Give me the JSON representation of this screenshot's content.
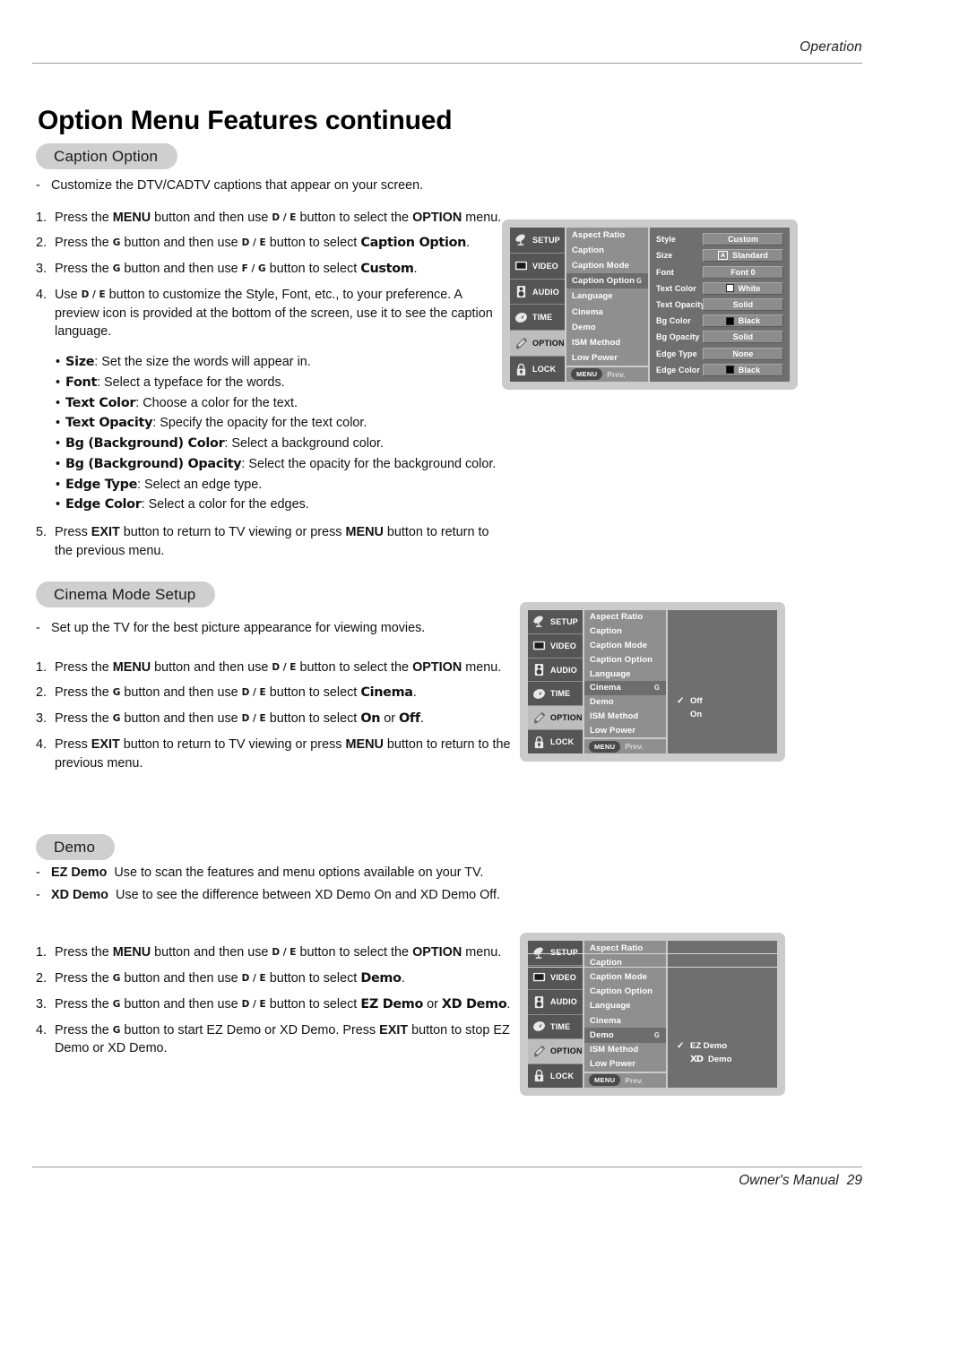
{
  "header": {
    "running_head": "Operation"
  },
  "title": "Option Menu Features continued",
  "footer": {
    "text": "Owner's Manual",
    "page": "29"
  },
  "sections": [
    {
      "pill": "Caption Option",
      "intro": "Customize the DTV/CADTV captions that appear on your screen.",
      "steps": [
        "1.|Press the |MENU| button and then use |D / E| button to select the |OPTION| menu.",
        "2.|Press the |G| button and then use |D / E| button to select |Caption Option|.",
        "3.|Press the |G| button and then use |F / G| button to select |Custom|.",
        "4.|Use |D / E| button to customize the Style, Font, etc., to your preference. A preview icon is provided at the bottom of the screen, use it to see the caption language."
      ],
      "bullets": [
        {
          "term": "Size",
          "desc": ": Set the size the words will appear in."
        },
        {
          "term": "Font",
          "desc": ": Select a typeface for the words."
        },
        {
          "term": "Text Color",
          "desc": ": Choose a color for the text."
        },
        {
          "term": "Text Opacity",
          "desc": ": Specify the opacity for the text color."
        },
        {
          "term": "Bg (Background) Color",
          "desc": ": Select a background color."
        },
        {
          "term": "Bg (Background) Opacity",
          "desc": ": Select the opacity for the background color."
        },
        {
          "term": "Edge Type",
          "desc": ": Select an edge type."
        },
        {
          "term": "Edge Color",
          "desc": ": Select a color for the edges."
        }
      ],
      "last_step": "5."
    },
    {
      "pill": "Cinema Mode Setup",
      "intro": "Set up the TV for the best picture appearance for viewing movies."
    },
    {
      "pill": "Demo",
      "dash1_term": "EZ Demo",
      "dash1_desc": "Use to scan the features and menu options available on your TV.",
      "dash2_term": "XD Demo",
      "dash2_desc": "Use to see the difference between XD Demo On and XD Demo Off."
    }
  ],
  "text": {
    "press_the": "Press the",
    "button_and_then_use": "button and then use",
    "button_to_select_the": "button to select the",
    "button_to_select": "button to select",
    "menu_word": "menu",
    "menu_period": "menu.",
    "or_word": "or",
    "use_word": "Use",
    "btn_menu": "MENU",
    "btn_option": "OPTION",
    "btn_exit": "EXIT",
    "btn_custom": "Custom",
    "btn_caption_option": "Caption Option",
    "btn_cinema": "Cinema",
    "btn_demo": "Demo",
    "btn_on": "On",
    "btn_off": "Off",
    "btn_ez_demo": "EZ Demo",
    "btn_xd_demo": "XD Demo",
    "key_de": "D / E",
    "key_fg": "F / G",
    "key_g": "G",
    "s1_step4_rest": "button to customize the Style, Font, etc., to your preference. A preview icon is provided at the bottom of the screen, use it to see the caption language.",
    "s1_step5": "Press EXIT button to return to TV viewing or press MENU button to return to the previous menu.",
    "s2_step4": "Press EXIT button to return to TV viewing or press MENU button to return to the previous menu.",
    "s3_step4_a": "button to start EZ Demo or XD Demo. Press",
    "s3_step4_b": "button to stop EZ Demo or XD Demo."
  },
  "osd": {
    "sidebar": [
      {
        "label": "SETUP",
        "icon": "satellite-dish-icon"
      },
      {
        "label": "VIDEO",
        "icon": "tv-screen-icon"
      },
      {
        "label": "AUDIO",
        "icon": "speaker-icon"
      },
      {
        "label": "TIME",
        "icon": "clock-icon"
      },
      {
        "label": "OPTION",
        "icon": "tag-icon"
      },
      {
        "label": "LOCK",
        "icon": "padlock-icon"
      }
    ],
    "menu_items": [
      "Aspect Ratio",
      "Caption",
      "Caption Mode",
      "Caption Option",
      "Language",
      "Cinema",
      "Demo",
      "ISM Method",
      "Low Power"
    ],
    "menu_chip": "MENU",
    "prev_label": "Prev.",
    "arrow_glyph": "G",
    "check_glyph": "✓",
    "diagram1": {
      "selected_item": "Caption Option",
      "rows": [
        {
          "label": "Style",
          "value": "Custom",
          "swatch": null,
          "abox": false
        },
        {
          "label": "Size",
          "value": "Standard",
          "swatch": null,
          "abox": true
        },
        {
          "label": "Font",
          "value": "Font  0",
          "swatch": null,
          "abox": false
        },
        {
          "label": "Text Color",
          "value": "White",
          "swatch": "#ffffff",
          "abox": false
        },
        {
          "label": "Text Opacity",
          "value": "Solid",
          "swatch": null,
          "abox": false
        },
        {
          "label": "Bg Color",
          "value": "Black",
          "swatch": "#000000",
          "abox": false
        },
        {
          "label": "Bg Opacity",
          "value": "Solid",
          "swatch": null,
          "abox": false
        },
        {
          "label": "Edge Type",
          "value": "None",
          "swatch": null,
          "abox": false
        },
        {
          "label": "Edge Color",
          "value": "Black",
          "swatch": "#000000",
          "abox": false
        }
      ]
    },
    "diagram2": {
      "selected_item": "Cinema",
      "options": [
        {
          "label": "Off",
          "checked": true
        },
        {
          "label": "On",
          "checked": false
        }
      ]
    },
    "diagram3": {
      "selected_item": "Demo",
      "options": [
        {
          "label": "EZ Demo",
          "checked": true,
          "logo": null
        },
        {
          "label": "Demo",
          "checked": false,
          "logo": "XD"
        }
      ]
    }
  },
  "colors": {
    "pill_bg": "#cfcfcf",
    "osd_frame": "#cbcbcb",
    "osd_sidebar": "#555555",
    "osd_sidebar_active": "#bdbdbd",
    "osd_list": "#8f8f8f",
    "osd_list_sel": "#6d6d6d",
    "osd_right": "#6f6f6f",
    "osd_value": "#8c8c8c"
  }
}
